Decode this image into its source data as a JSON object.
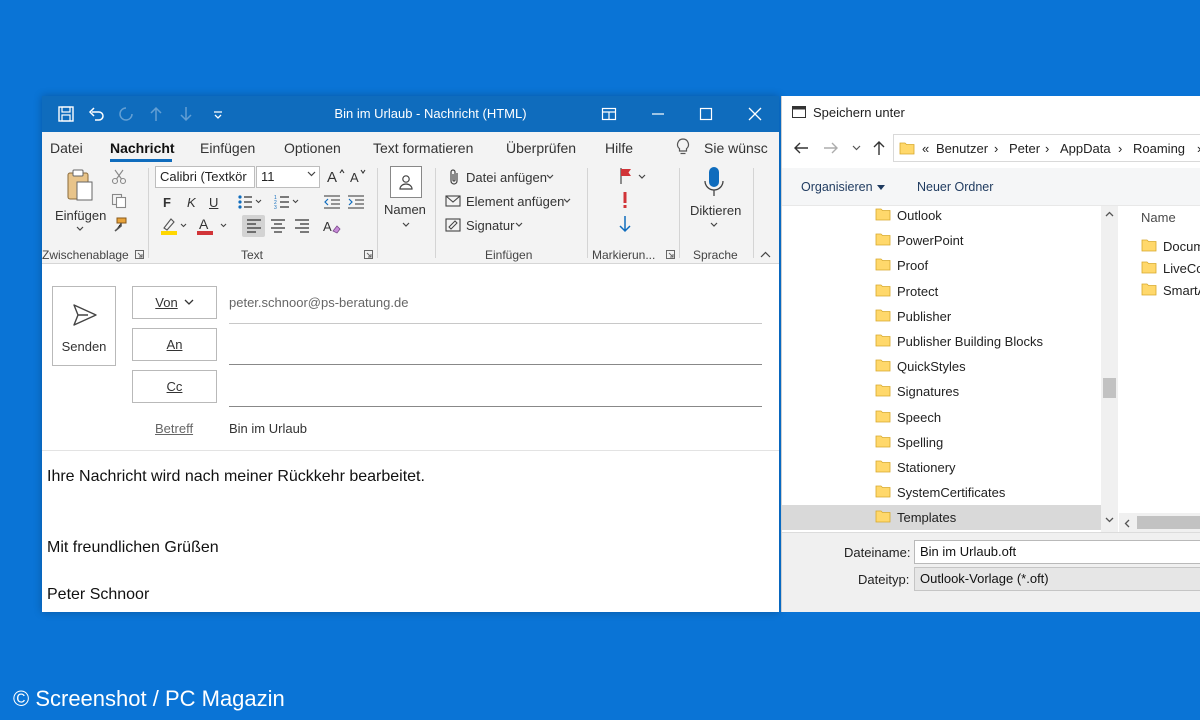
{
  "outlook": {
    "title": "Bin im Urlaub  -  Nachricht (HTML)",
    "colors": {
      "titlebar": "#0f6cbd",
      "accent": "#0f6cbd",
      "flag": "#d13438",
      "font_color": "#d13438",
      "highlight": "#ffd700"
    },
    "quick_access_icons": [
      "save-icon",
      "undo-icon",
      "redo-icon",
      "arrow-up-icon",
      "arrow-down-icon",
      "customize-icon"
    ],
    "menu": [
      "Datei",
      "Nachricht",
      "Einfügen",
      "Optionen",
      "Text formatieren",
      "Überprüfen",
      "Hilfe"
    ],
    "menu_active": "Nachricht",
    "tell_me": "Sie wünsc",
    "ribbon": {
      "groups": {
        "clipboard": "Zwischenablage",
        "text": "Text",
        "insert": "Einfügen",
        "tags": "Markierun...",
        "voice": "Sprache"
      },
      "paste_label": "Einfügen",
      "font_name": "Calibri (Textkör",
      "font_size": "11",
      "bold": "F",
      "italic": "K",
      "underline": "U",
      "names_label": "Namen",
      "attach_file": "Datei anfügen",
      "attach_item": "Element anfügen",
      "signature": "Signatur",
      "dictate": "Diktieren"
    },
    "header": {
      "send_label": "Senden",
      "from_label": "Von",
      "from_value": "peter.schnoor@ps-beratung.de",
      "to_label": "An",
      "cc_label": "Cc",
      "subject_label": "Betreff",
      "subject_value": "Bin im Urlaub"
    },
    "body_lines": [
      "Ihre Nachricht wird nach meiner Rückkehr bearbeitet.",
      "Mit freundlichen Grüßen",
      "Peter Schnoor"
    ]
  },
  "save_dialog": {
    "title": "Speichern unter",
    "breadcrumb": [
      "«",
      "Benutzer",
      "Peter",
      "AppData",
      "Roaming"
    ],
    "organize": "Organisieren",
    "new_folder": "Neuer Ordner",
    "tree": [
      "Outlook",
      "PowerPoint",
      "Proof",
      "Protect",
      "Publisher",
      "Publisher Building Blocks",
      "QuickStyles",
      "Signatures",
      "Speech",
      "Spelling",
      "Stationery",
      "SystemCertificates",
      "Templates"
    ],
    "selected_folder": "Templates",
    "list_header": "Name",
    "list_items": [
      "Docum",
      "LiveCo",
      "SmartA"
    ],
    "filename_label": "Dateiname:",
    "filename_value": "Bin im Urlaub.oft",
    "filetype_label": "Dateityp:",
    "filetype_value": "Outlook-Vorlage (*.oft)",
    "colors": {
      "folder": "#ffd86b",
      "selected_row": "#d9d9d9",
      "link_text": "#1e3a5f"
    }
  },
  "watermark": "© Screenshot / PC Magazin"
}
